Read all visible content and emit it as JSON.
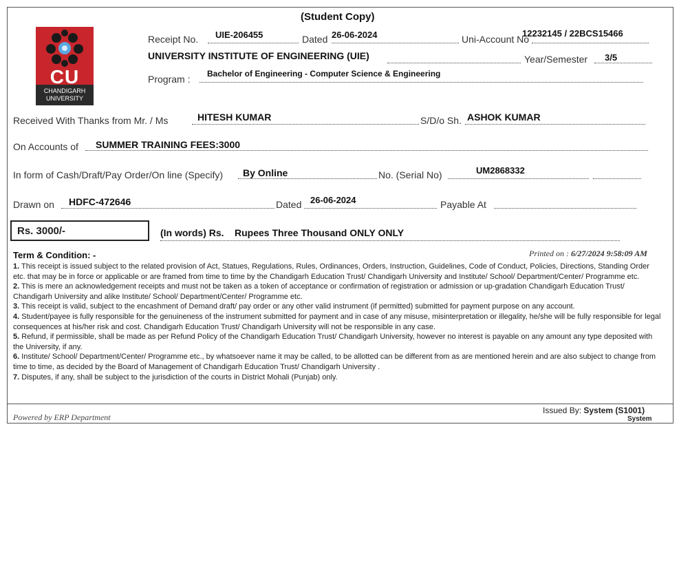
{
  "title": "(Student Copy)",
  "logo": {
    "mark": "CU",
    "line1": "CHANDIGARH",
    "line2": "UNIVERSITY"
  },
  "labels": {
    "receipt_no": "Receipt No.",
    "dated": "Dated",
    "uni_account": "Uni-Account No",
    "year_semester": "Year/Semester",
    "program": "Program :",
    "received_from": "Received With Thanks from  Mr. / Ms",
    "sdo": "S/D/o Sh.",
    "on_accounts": "On Accounts of",
    "form_of_payment": "In form of Cash/Draft/Pay Order/On line (Specify)",
    "serial_no": "No. (Serial No)",
    "drawn_on": "Drawn on",
    "dated2": "Dated",
    "payable_at": "Payable At",
    "in_words": "(In words) Rs."
  },
  "values": {
    "receipt_no": "UIE-206455",
    "dated": "26-06-2024",
    "uni_account": "12232145 / 22BCS15466",
    "institute": "UNIVERSITY INSTITUTE OF ENGINEERING (UIE)",
    "year_semester": "3/5",
    "program": "Bachelor of Engineering - Computer Science & Engineering",
    "name": "HITESH KUMAR",
    "parent": "ASHOK KUMAR",
    "on_accounts": "SUMMER TRAINING FEES:3000",
    "payment_mode": "By Online",
    "serial_no": "UM2868332",
    "drawn_on": "HDFC-472646",
    "drawn_date": "26-06-2024",
    "amount": "Rs. 3000/-",
    "amount_words": "Rupees Three Thousand  ONLY ONLY"
  },
  "terms": {
    "heading": "Term & Condition: -",
    "printed_label": "Printed on :",
    "printed_value": "6/27/2024 9:58:09 AM",
    "items": [
      {
        "num": "1.",
        "text": "This receipt is issued subject to the related provision of Act, Statues, Regulations, Rules, Ordinances, Orders, Instruction, Guidelines, Code of Conduct, Policies, Directions, Standing Order etc. that may be in force or applicable or are framed from time to time by the Chandigarh Education Trust/ Chandigarh University and  Institute/ School/ Department/Center/ Programme etc."
      },
      {
        "num": "2.",
        "text": "This is mere an acknowledgement receipts and must not be taken as a token of acceptance or confirmation of registration or admission or up-gradation Chandigarh Education Trust/ Chandigarh University and alike Institute/ School/ Department/Center/ Programme etc."
      },
      {
        "num": "3.",
        "text": "This receipt is valid, subject to the encashment of Demand draft/ pay order or any other valid instrument (if permitted) submitted for payment purpose on any account."
      },
      {
        "num": "4.",
        "text": "Student/payee is fully responsible for the genuineness of the instrument submitted for payment and in case of any misuse, misinterpretation or illegality, he/she will be fully responsible for legal consequences at his/her risk and cost. Chandigarh Education Trust/ Chandigarh University will not be responsible in any case."
      },
      {
        "num": "5.",
        "text": "Refund, if permissible, shall be made as per Refund Policy of the Chandigarh Education Trust/ Chandigarh University, however no interest is payable on any amount any type deposited with the University, if any."
      },
      {
        "num": "6.",
        "text": "Institute/ School/ Department/Center/ Programme etc., by whatsoever name it may be called, to be allotted can be different from as are mentioned herein and are also subject to change from time to time, as decided by the  Board of Management of Chandigarh Education Trust/ Chandigarh University ."
      },
      {
        "num": "7.",
        "text": "Disputes, if any, shall be subject to the jurisdiction of the courts in District Mohali (Punjab) only."
      }
    ]
  },
  "footer": {
    "powered_by": "Powered by ERP Department",
    "issued_by_label": "Issued By:",
    "issued_by_value": "System (S1001)",
    "issued_by_sub": "System"
  }
}
